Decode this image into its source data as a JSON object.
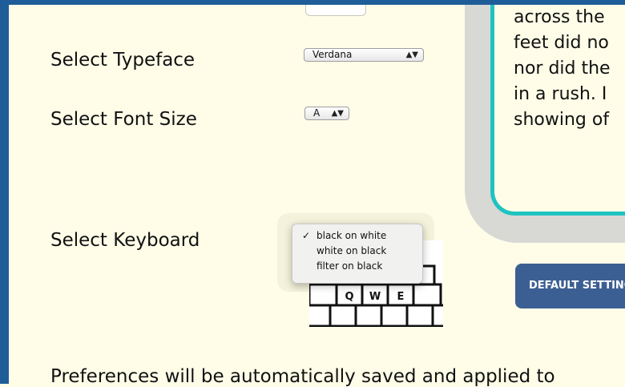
{
  "settings": {
    "typeface_label": "Select Typeface",
    "typeface_value": "Verdana",
    "font_size_label": "Select Font Size",
    "font_size_value": "A",
    "keyboard_label": "Select Keyboard",
    "keyboard_options": [
      {
        "label": "black on white",
        "selected": true
      },
      {
        "label": "white on black",
        "selected": false
      },
      {
        "label": "filter on black",
        "selected": false
      }
    ],
    "keyboard_keys": [
      "Q",
      "W",
      "E"
    ]
  },
  "preview": {
    "lines": [
      "across the",
      "feet did no",
      "nor did the",
      "in a rush. I",
      "showing of"
    ]
  },
  "buttons": {
    "default_settings": "DEFAULT SETTINGS"
  },
  "footer": {
    "text": "Preferences will be automatically saved and applied to"
  },
  "colors": {
    "frame": "#1f5d99",
    "background": "#fffde8",
    "preview_border": "#1ec3c0",
    "button": "#3c5f93"
  }
}
